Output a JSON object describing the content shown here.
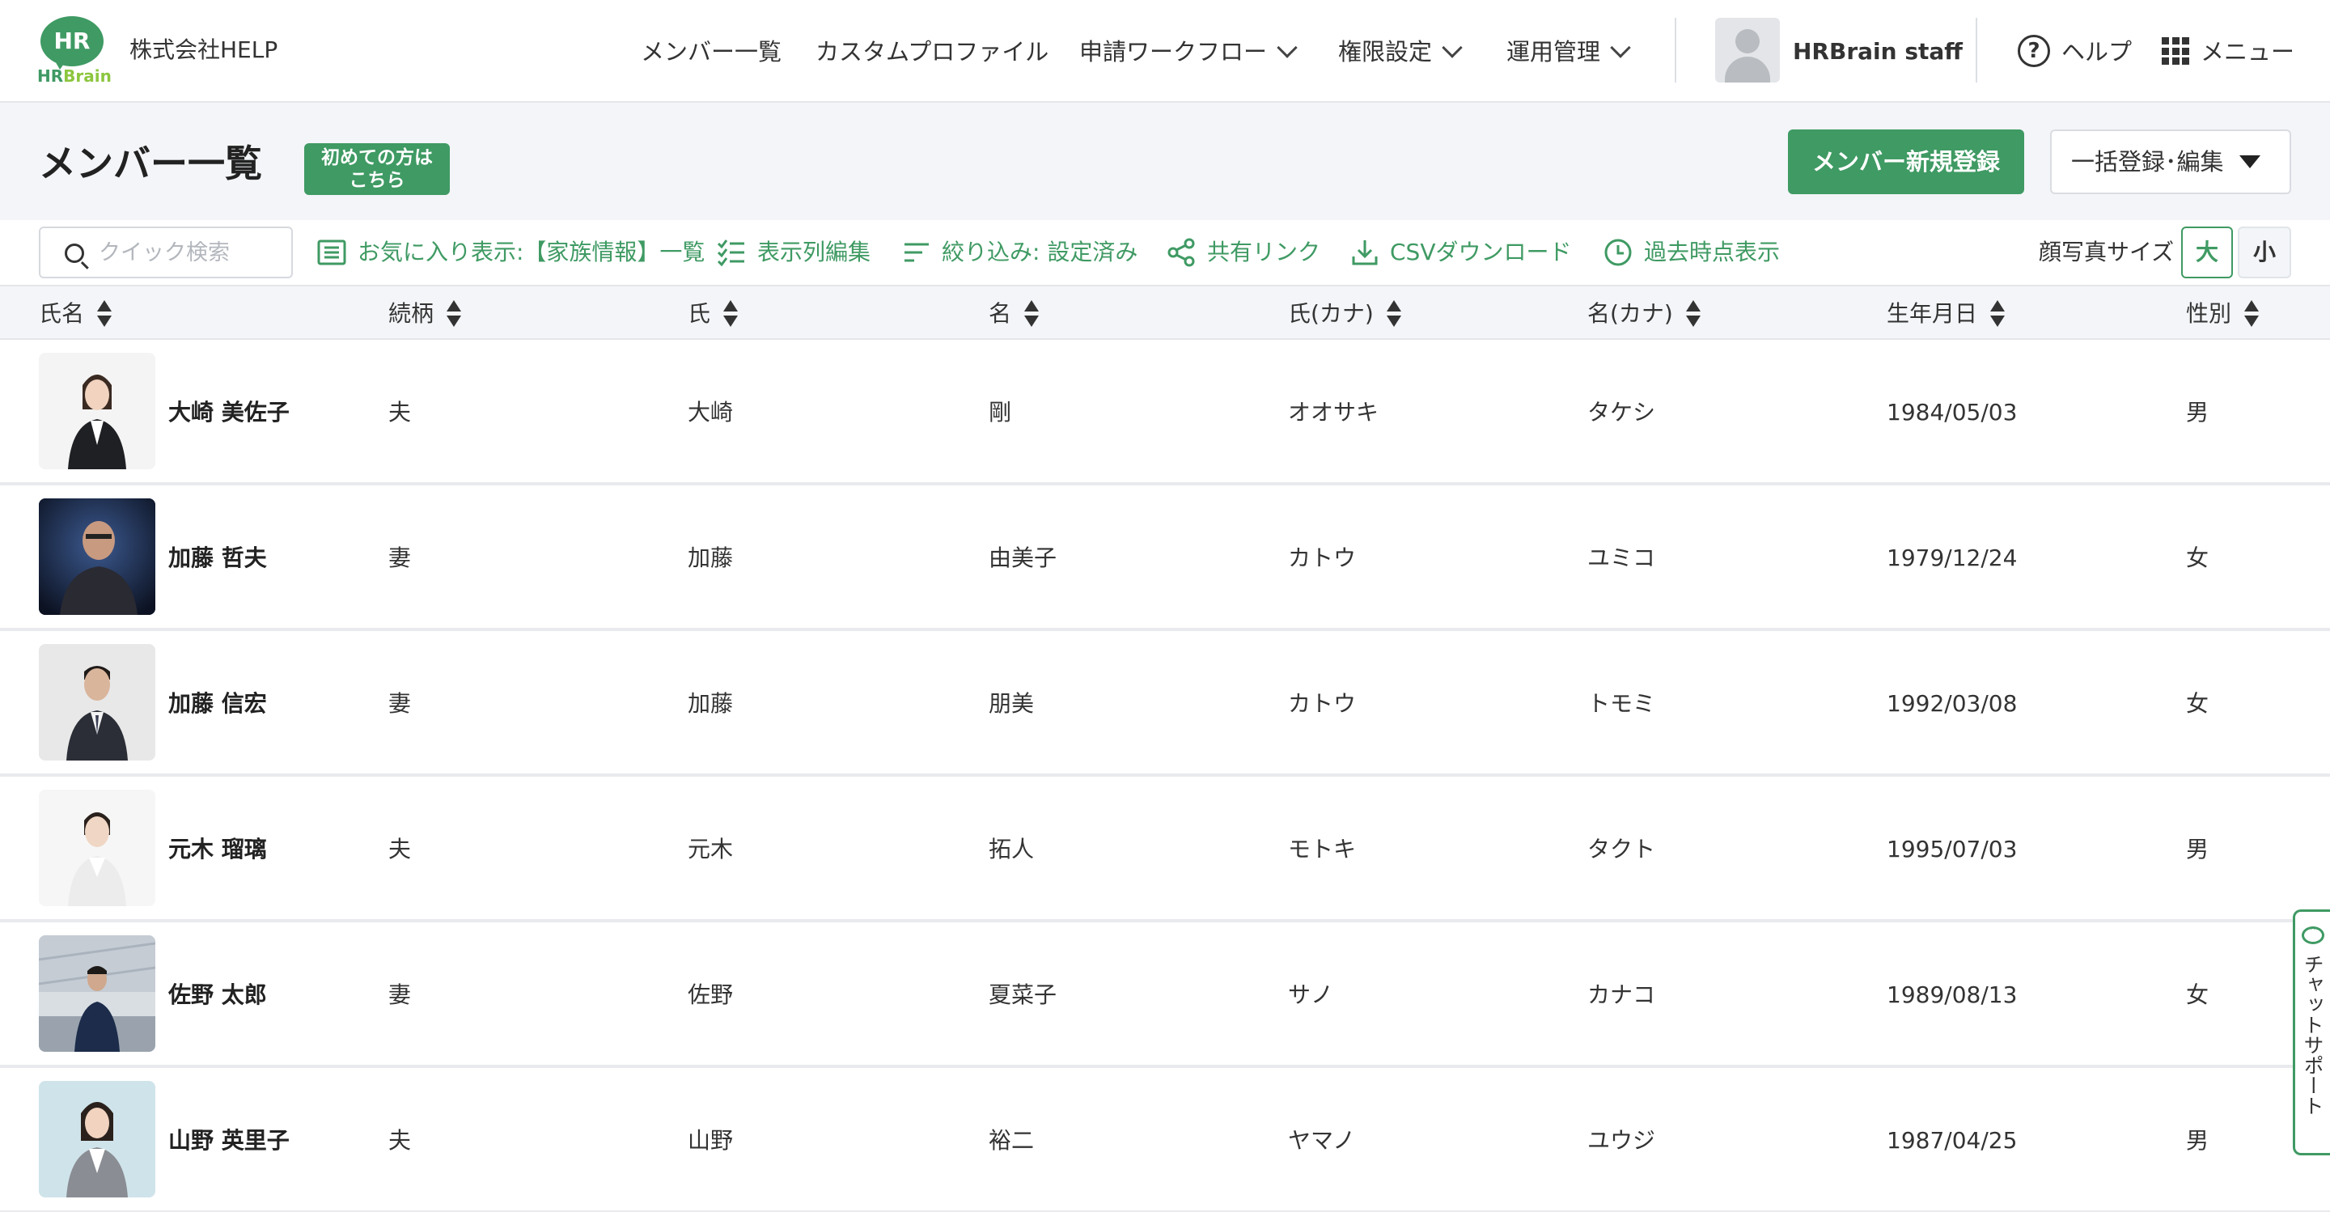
{
  "header": {
    "logo_text": "HR",
    "logo_sub_hr": "HR",
    "logo_sub_brain": "Brain",
    "company": "株式会社HELP",
    "nav": [
      {
        "label": "メンバー一覧"
      },
      {
        "label": "カスタムプロファイル"
      },
      {
        "label": "申請ワークフロー"
      },
      {
        "label": "権限設定"
      },
      {
        "label": "運用管理"
      }
    ],
    "user_name": "HRBrain staff",
    "help_label": "ヘルプ",
    "menu_label": "メニュー"
  },
  "title_band": {
    "title": "メンバー一覧",
    "first_badge_line1": "初めての方は",
    "first_badge_line2": "こちら",
    "new_member_button": "メンバー新規登録",
    "bulk_button": "一括登録･編集"
  },
  "toolbar": {
    "search_placeholder": "クイック検索",
    "favorite_view": "お気に入り表示:【家族情報】一覧",
    "edit_columns": "表示列編集",
    "filter": "絞り込み: 設定済み",
    "share_link": "共有リンク",
    "csv_download": "CSVダウンロード",
    "past_view": "過去時点表示",
    "photo_size_label": "顔写真サイズ",
    "size_large": "大",
    "size_small": "小"
  },
  "table": {
    "columns": [
      "氏名",
      "続柄",
      "氏",
      "名",
      "氏(カナ)",
      "名(カナ)",
      "生年月日",
      "性別"
    ],
    "rows": [
      {
        "name": "大崎 美佐子",
        "relation": "夫",
        "last": "大崎",
        "first": "剛",
        "last_kana": "オオサキ",
        "first_kana": "タケシ",
        "birth": "1984/05/03",
        "gender": "男"
      },
      {
        "name": "加藤 哲夫",
        "relation": "妻",
        "last": "加藤",
        "first": "由美子",
        "last_kana": "カトウ",
        "first_kana": "ユミコ",
        "birth": "1979/12/24",
        "gender": "女"
      },
      {
        "name": "加藤 信宏",
        "relation": "妻",
        "last": "加藤",
        "first": "朋美",
        "last_kana": "カトウ",
        "first_kana": "トモミ",
        "birth": "1992/03/08",
        "gender": "女"
      },
      {
        "name": "元木 瑠璃",
        "relation": "夫",
        "last": "元木",
        "first": "拓人",
        "last_kana": "モトキ",
        "first_kana": "タクト",
        "birth": "1995/07/03",
        "gender": "男"
      },
      {
        "name": "佐野 太郎",
        "relation": "妻",
        "last": "佐野",
        "first": "夏菜子",
        "last_kana": "サノ",
        "first_kana": "カナコ",
        "birth": "1989/08/13",
        "gender": "女"
      },
      {
        "name": "山野 英里子",
        "relation": "夫",
        "last": "山野",
        "first": "裕二",
        "last_kana": "ヤマノ",
        "first_kana": "ユウジ",
        "birth": "1987/04/25",
        "gender": "男"
      }
    ]
  },
  "chat_support": "チャットサポート",
  "colors": {
    "brand_green": "#3f9a63",
    "band_bg": "#f3f5f8",
    "text": "#333333"
  }
}
